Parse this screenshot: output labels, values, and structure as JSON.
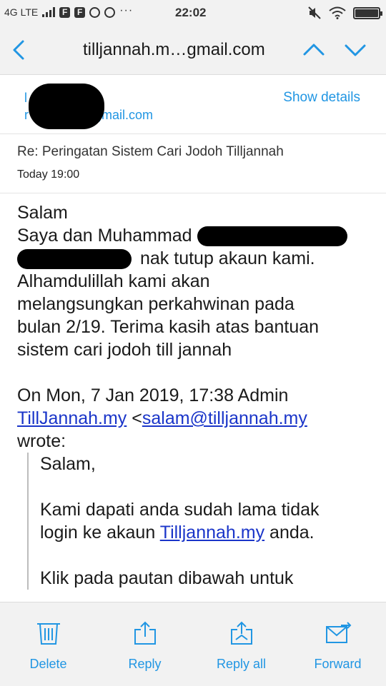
{
  "status_bar": {
    "network": "4G LTE",
    "app_icons": [
      "F",
      "F"
    ],
    "overflow": "···",
    "time": "22:02"
  },
  "header": {
    "title": "tilljannah.m…gmail.com",
    "icons": {
      "back": "chevron-left-icon",
      "up": "chevron-up-icon",
      "down": "chevron-down-icon"
    }
  },
  "sender": {
    "name_initial": "l",
    "email_start": "r",
    "email_end": "gmail.com",
    "show_details": "Show details"
  },
  "message": {
    "subject": "Re: Peringatan Sistem Cari Jodoh Tilljannah",
    "date": "Today 19:00",
    "greeting": "Salam",
    "line1": "Saya dan Muhammad",
    "line2_after": "nak tutup akaun kami.",
    "line3": "Alhamdulillah kami akan",
    "line4": "melangsungkan perkahwinan pada",
    "line5": "bulan 2/19. Terima kasih atas bantuan",
    "line6": "sistem cari jodoh till jannah",
    "quote_header_1": "On Mon, 7 Jan 2019, 17:38 Admin",
    "quote_link": "TillJannah.my",
    "quote_lt": "<",
    "quote_email": "salam@tilljannah.my",
    "quote_wrote": "wrote:",
    "quoted": {
      "greeting": "Salam,",
      "line1": "Kami dapati anda sudah lama tidak",
      "line2_before": "login ke akaun ",
      "line2_link": "Tilljannah.my",
      "line2_after": " anda.",
      "line3": "Klik pada pautan dibawah untuk"
    }
  },
  "toolbar": {
    "delete": "Delete",
    "reply": "Reply",
    "reply_all": "Reply all",
    "forward": "Forward"
  },
  "colors": {
    "accent": "#2196e3",
    "link": "#1a35c9",
    "bar": "#f2f2f2"
  }
}
